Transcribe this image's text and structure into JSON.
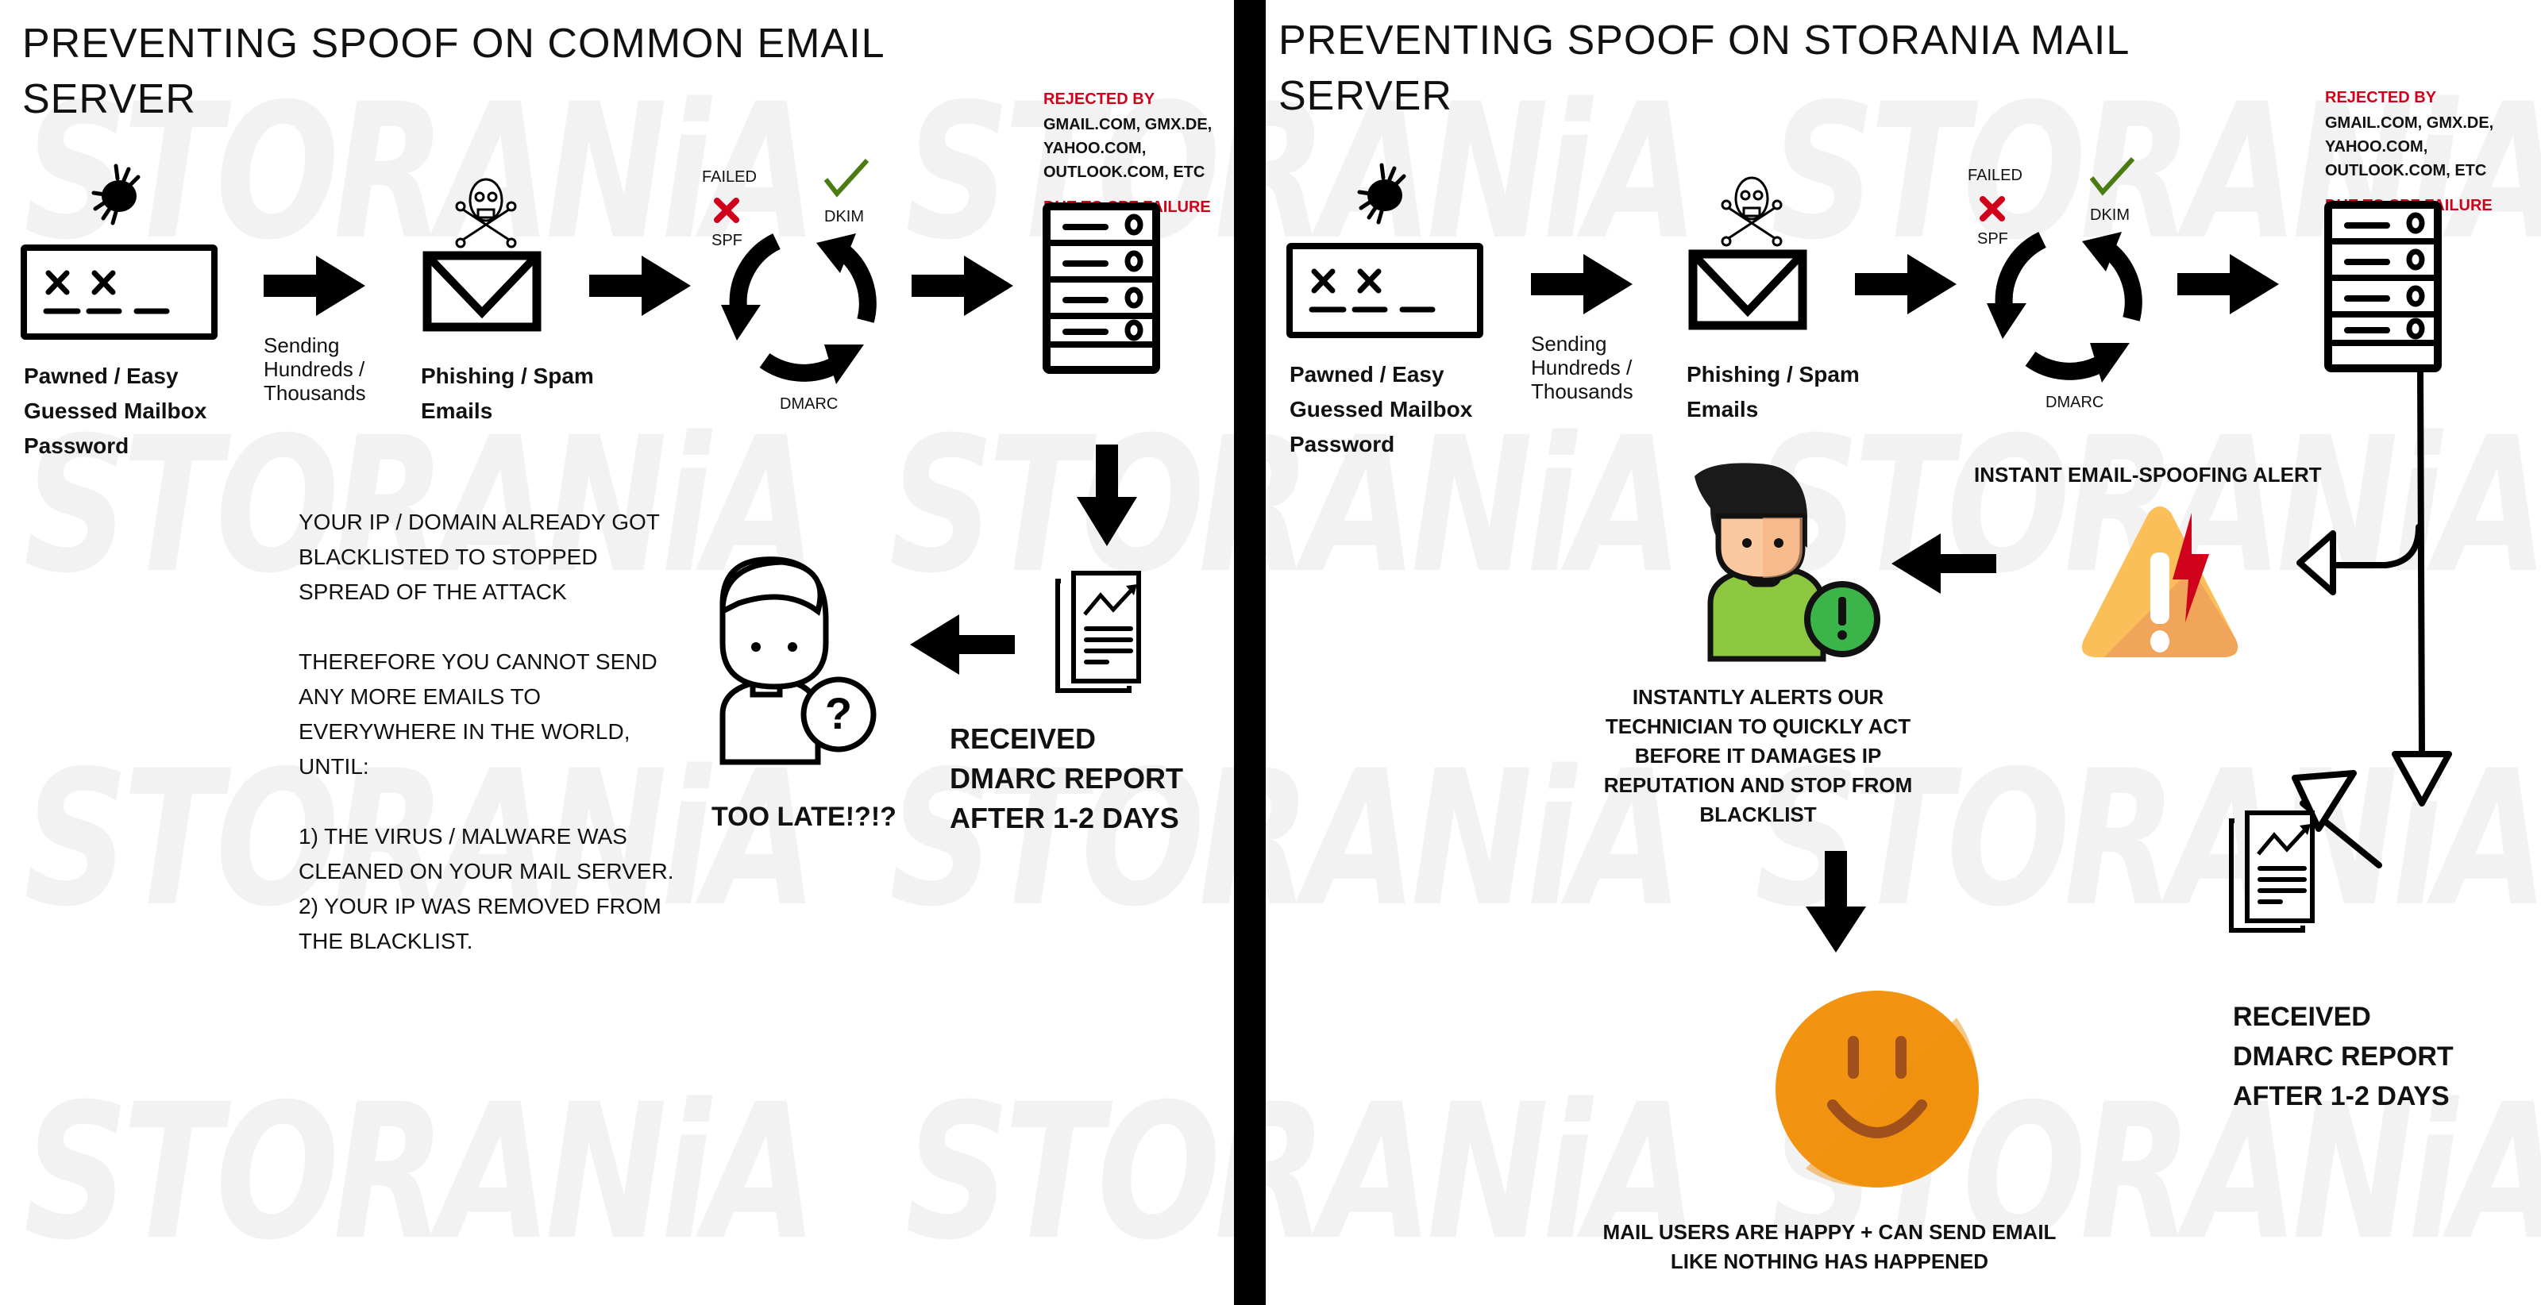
{
  "watermark": "STORANiA",
  "left": {
    "title_line1": "PREVENTING SPOOF ON COMMON EMAIL",
    "title_line2": "SERVER",
    "pawned_lines": [
      "Pawned / Easy",
      "Guessed Mailbox",
      "Password"
    ],
    "sending_lines": [
      "Sending",
      "Hundreds /",
      "Thousands"
    ],
    "phishing_lines": [
      "Phishing / Spam",
      "Emails"
    ],
    "checks": {
      "failed": "FAILED",
      "spf": "SPF",
      "dkim": "DKIM",
      "dmarc": "DMARC"
    },
    "rejected": {
      "heading": "REJECTED BY",
      "lines": [
        "GMAIL.COM, GMX.DE,",
        "YAHOO.COM,",
        "OUTLOOK.COM,  ETC"
      ],
      "reason": "DUE TO SPF FAILURE"
    },
    "blacklist_text": [
      "YOUR IP / DOMAIN ALREADY GOT",
      "BLACKLISTED TO STOPPED",
      "SPREAD OF THE ATTACK",
      "",
      "THEREFORE YOU CANNOT SEND",
      "ANY MORE EMAILS TO",
      "EVERYWHERE IN THE WORLD,",
      "UNTIL:",
      "",
      "1) THE VIRUS / MALWARE WAS",
      "CLEANED ON YOUR MAIL SERVER.",
      "2) YOUR IP WAS REMOVED FROM",
      "THE BLACKLIST."
    ],
    "too_late": "TOO LATE!?!?",
    "report_lines": [
      "RECEIVED",
      "DMARC REPORT",
      "AFTER 1-2 DAYS"
    ]
  },
  "right": {
    "title_line1": "PREVENTING SPOOF ON STORANIA MAIL",
    "title_line2": "SERVER",
    "pawned_lines": [
      "Pawned / Easy",
      "Guessed Mailbox",
      "Password"
    ],
    "sending_lines": [
      "Sending",
      "Hundreds /",
      "Thousands"
    ],
    "phishing_lines": [
      "Phishing / Spam",
      "Emails"
    ],
    "checks": {
      "failed": "FAILED",
      "spf": "SPF",
      "dkim": "DKIM",
      "dmarc": "DMARC"
    },
    "rejected": {
      "heading": "REJECTED BY",
      "lines": [
        "GMAIL.COM, GMX.DE,",
        "YAHOO.COM,",
        "OUTLOOK.COM,  ETC"
      ],
      "reason": "DUE TO SPF FAILURE"
    },
    "alert_label": "INSTANT EMAIL-SPOOFING ALERT",
    "technician_lines": [
      "INSTANTLY ALERTS OUR",
      "TECHNICIAN TO QUICKLY ACT",
      "BEFORE IT DAMAGES IP",
      "REPUTATION AND STOP FROM",
      "BLACKLIST"
    ],
    "report_lines": [
      "RECEIVED",
      "DMARC REPORT",
      "AFTER 1-2 DAYS"
    ],
    "happy_lines": [
      "MAIL USERS ARE HAPPY + CAN SEND EMAIL",
      "LIKE NOTHING HAS HAPPENED"
    ]
  },
  "colors": {
    "fail_red": "#d0021b",
    "pass_green": "#4a7c12",
    "warning_orange": "#fbbf5a",
    "alert_green": "#3bb54a",
    "shirt_green": "#8dc63f",
    "smiley_orange": "#f29411",
    "smiley_features": "#a0501a"
  }
}
